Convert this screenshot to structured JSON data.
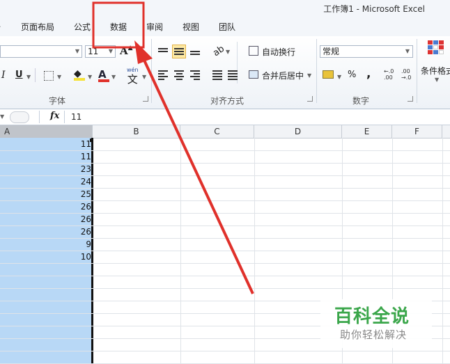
{
  "window": {
    "title": "工作簿1 - Microsoft Excel"
  },
  "tabs": [
    "页面布局",
    "公式",
    "数据",
    "审阅",
    "视图",
    "团队"
  ],
  "ribbon": {
    "font_group": {
      "label": "字体",
      "font_size": "11",
      "underline": "U",
      "italic": "I",
      "grow_font": "A",
      "font_color_glyph": "A",
      "phonetic_glyph": "文",
      "phonetic_small": "wén"
    },
    "align_group": {
      "label": "对齐方式",
      "wrap_text": "自动换行",
      "merge_center": "合并后居中"
    },
    "number_group": {
      "label": "数字",
      "format": "常规",
      "percent": "%",
      "comma": ",",
      "inc_decimal": "←.0 .00",
      "dec_decimal": ".00 →.0"
    },
    "styles_group": {
      "conditional_format": "条件格式"
    }
  },
  "formula_bar": {
    "fx": "fx",
    "value": "11"
  },
  "columns": [
    "A",
    "B",
    "C",
    "D",
    "E",
    "F"
  ],
  "cells_a": [
    "11",
    "11",
    "23",
    "24",
    "25",
    "26",
    "26",
    "26",
    "9",
    "10"
  ],
  "watermark": {
    "title": "百科全说",
    "subtitle": "助你轻松解决"
  },
  "colors": {
    "highlight_box": "#e0312b",
    "arrow": "#e0312b",
    "selection": "#b8d8f6",
    "watermark_green": "#3aa64a"
  }
}
